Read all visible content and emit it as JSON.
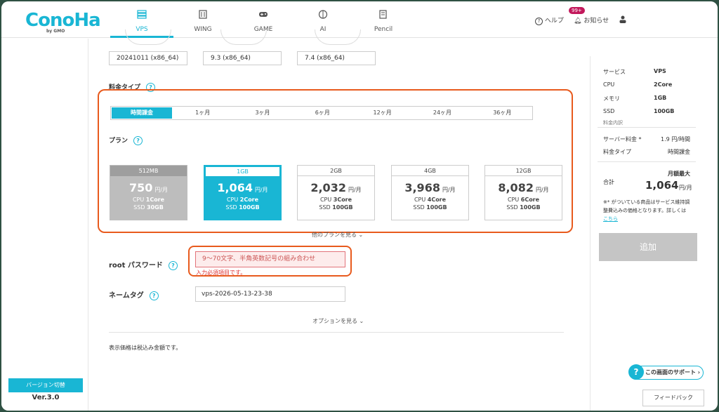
{
  "header": {
    "logo": "ConoHa",
    "logo_sub": "by GMO",
    "tabs": [
      {
        "label": "VPS",
        "icon": "server-icon"
      },
      {
        "label": "WING",
        "icon": "building-icon"
      },
      {
        "label": "GAME",
        "icon": "gamepad-icon"
      },
      {
        "label": "AI",
        "icon": "brain-icon"
      },
      {
        "label": "Pencil",
        "icon": "pencil-doc-icon"
      }
    ],
    "help_label": "ヘルプ",
    "notifications_label": "お知らせ",
    "notifications_badge": "99+"
  },
  "sidebar": {
    "version_switch": "バージョン切替",
    "version_text": "Ver.3.0"
  },
  "image_versions": [
    "20241011 (x86_64)",
    "9.3 (x86_64)",
    "7.4 (x86_64)"
  ],
  "pricing": {
    "label": "料金タイプ",
    "periods": [
      "時間課金",
      "1ヶ月",
      "3ヶ月",
      "6ヶ月",
      "12ヶ月",
      "24ヶ月",
      "36ヶ月"
    ]
  },
  "plan": {
    "label": "プラン",
    "plans": [
      {
        "name": "512MB",
        "price": "750",
        "unit": "円/月",
        "cpu_prefix": "CPU ",
        "cpu": "1Core",
        "ssd_prefix": "SSD ",
        "ssd": "30GB"
      },
      {
        "name": "1GB",
        "price": "1,064",
        "unit": "円/月",
        "cpu_prefix": "CPU ",
        "cpu": "2Core",
        "ssd_prefix": "SSD ",
        "ssd": "100GB"
      },
      {
        "name": "2GB",
        "price": "2,032",
        "unit": "円/月",
        "cpu_prefix": "CPU ",
        "cpu": "3Core",
        "ssd_prefix": "SSD ",
        "ssd": "100GB"
      },
      {
        "name": "4GB",
        "price": "3,968",
        "unit": "円/月",
        "cpu_prefix": "CPU ",
        "cpu": "4Core",
        "ssd_prefix": "SSD ",
        "ssd": "100GB"
      },
      {
        "name": "12GB",
        "price": "8,082",
        "unit": "円/月",
        "cpu_prefix": "CPU ",
        "cpu": "6Core",
        "ssd_prefix": "SSD ",
        "ssd": "100GB"
      }
    ],
    "more_link": "他のプランを見る"
  },
  "root_password": {
    "label": "root パスワード",
    "placeholder": "9～70文字、半角英数記号の組み合わせ",
    "error": "入力必須項目です。"
  },
  "name_tag": {
    "label": "ネームタグ",
    "value": "vps-2026-05-13-23-38"
  },
  "options_link": "オプションを見る",
  "tax_note": "表示価格は税込み金額です。",
  "summary": {
    "rows": [
      {
        "label": "サービス",
        "value": "VPS"
      },
      {
        "label": "CPU",
        "value": "2Core"
      },
      {
        "label": "メモリ",
        "value": "1GB"
      },
      {
        "label": "SSD",
        "value": "100GB"
      }
    ],
    "breakdown_label": "料金内訳",
    "server_fee_label": "サーバー料金 *",
    "server_fee_value": "1.9 円/時間",
    "fee_type_label": "料金タイプ",
    "fee_type_value": "時間課金",
    "total_label": "合計",
    "monthly_max": "月額最大",
    "total_value": "1,064",
    "total_unit": "円/月",
    "footnote": "※* がついている商品はサービス維持調整費込みの価格となります。詳しくは",
    "footnote_link": "こちら",
    "add_button": "追加"
  },
  "support_button": "この画面のサポート",
  "feedback_button": "フィードバック",
  "accent_color": "#19b6d4",
  "highlight_color": "#e85a1d"
}
